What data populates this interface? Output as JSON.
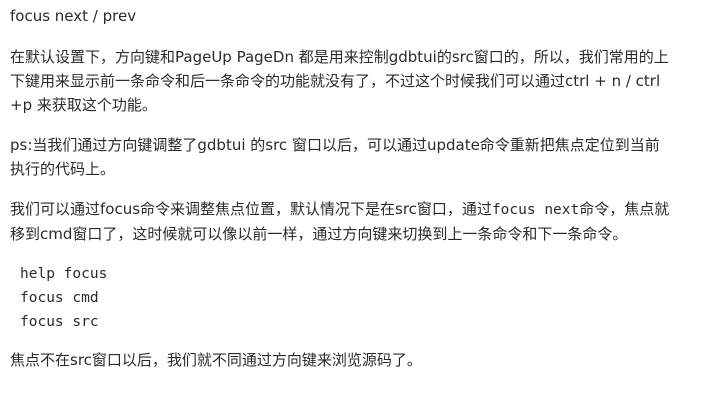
{
  "heading": "focus next / prev",
  "para1": "在默认设置下，方向键和PageUp PageDn 都是用来控制gdbtui的src窗口的，所以，我们常用的上下键用来显示前一条命令和后一条命令的功能就没有了，不过这个时候我们可以通过ctrl + n / ctrl +p 来获取这个功能。",
  "para2": "ps:当我们通过方向键调整了gdbtui 的src 窗口以后，可以通过update命令重新把焦点定位到当前执行的代码上。",
  "para3": {
    "before": "我们可以通过focus命令来调整焦点位置，默认情况下是在src窗口，通过",
    "code": "focus next",
    "after": "命令，焦点就移到cmd窗口了，这时候就可以像以前一样，通过方向键来切换到上一条命令和下一条命令。"
  },
  "code_lines": [
    "help focus",
    "focus cmd",
    "focus src"
  ],
  "para4": "焦点不在src窗口以后，我们就不同通过方向键来浏览源码了。"
}
